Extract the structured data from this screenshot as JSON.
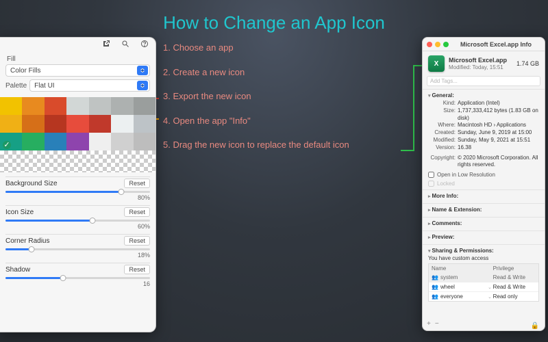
{
  "title": "How to Change an App Icon",
  "steps": [
    "1. Choose an app",
    "2. Create a new icon",
    "3. Export the new icon",
    "4. Open the app \"Info\"",
    "5. Drag the new icon to replace the default icon"
  ],
  "left": {
    "fill_label": "Fill",
    "fill_value": "Color Fills",
    "palette_label": "Palette",
    "palette_value": "Flat UI",
    "swatches": [
      "#f2c200",
      "#e88a1f",
      "#d94b2b",
      "#d2d7d6",
      "#bfc3c2",
      "#adb1b0",
      "#9a9e9d",
      "#f0b015",
      "#d66f18",
      "#b63620",
      "#e74c3c",
      "#c0392b",
      "#ecf0f1",
      "#bdc3c7",
      "#16a085",
      "#27ae60",
      "#2980b9",
      "#8e44ad",
      "#efefef",
      "#d0d0d0",
      "#bdbdbd"
    ],
    "selected_swatch_index": 14,
    "sliders": [
      {
        "label": "Background Size",
        "value": "80%",
        "pct": 80
      },
      {
        "label": "Icon Size",
        "value": "60%",
        "pct": 60
      },
      {
        "label": "Corner Radius",
        "value": "18%",
        "pct": 18
      },
      {
        "label": "Shadow",
        "value": "16",
        "pct": 40
      }
    ],
    "reset_label": "Reset"
  },
  "info": {
    "window_title": "Microsoft Excel.app Info",
    "app_name": "Microsoft Excel.app",
    "size": "1.74 GB",
    "modified_short": "Modified: Today, 15:51",
    "tags_placeholder": "Add Tags...",
    "general": {
      "title": "General:",
      "kind": "Application (Intel)",
      "size_long": "1,737,333,412 bytes (1.83 GB on disk)",
      "where": "Macintosh HD › Applications",
      "created": "Sunday, June 9, 2019 at 15:00",
      "modified": "Sunday, May 9, 2021 at 15:51",
      "version": "16.38",
      "copyright": "© 2020 Microsoft Corporation. All rights reserved.",
      "open_low_res": "Open in Low Resolution",
      "locked": "Locked",
      "labels": {
        "kind": "Kind:",
        "size": "Size:",
        "where": "Where:",
        "created": "Created:",
        "modified": "Modified:",
        "version": "Version:",
        "copyright": "Copyright:"
      }
    },
    "sections": {
      "more_info": "More Info:",
      "name_ext": "Name & Extension:",
      "comments": "Comments:",
      "preview": "Preview:",
      "sharing": "Sharing & Permissions:"
    },
    "sharing_note": "You have custom access",
    "perm_head": {
      "name": "Name",
      "priv": "Privilege"
    },
    "perms": [
      {
        "who": "system",
        "priv": "Read & Write"
      },
      {
        "who": "wheel",
        "priv": "Read & Write"
      },
      {
        "who": "everyone",
        "priv": "Read only"
      }
    ]
  }
}
